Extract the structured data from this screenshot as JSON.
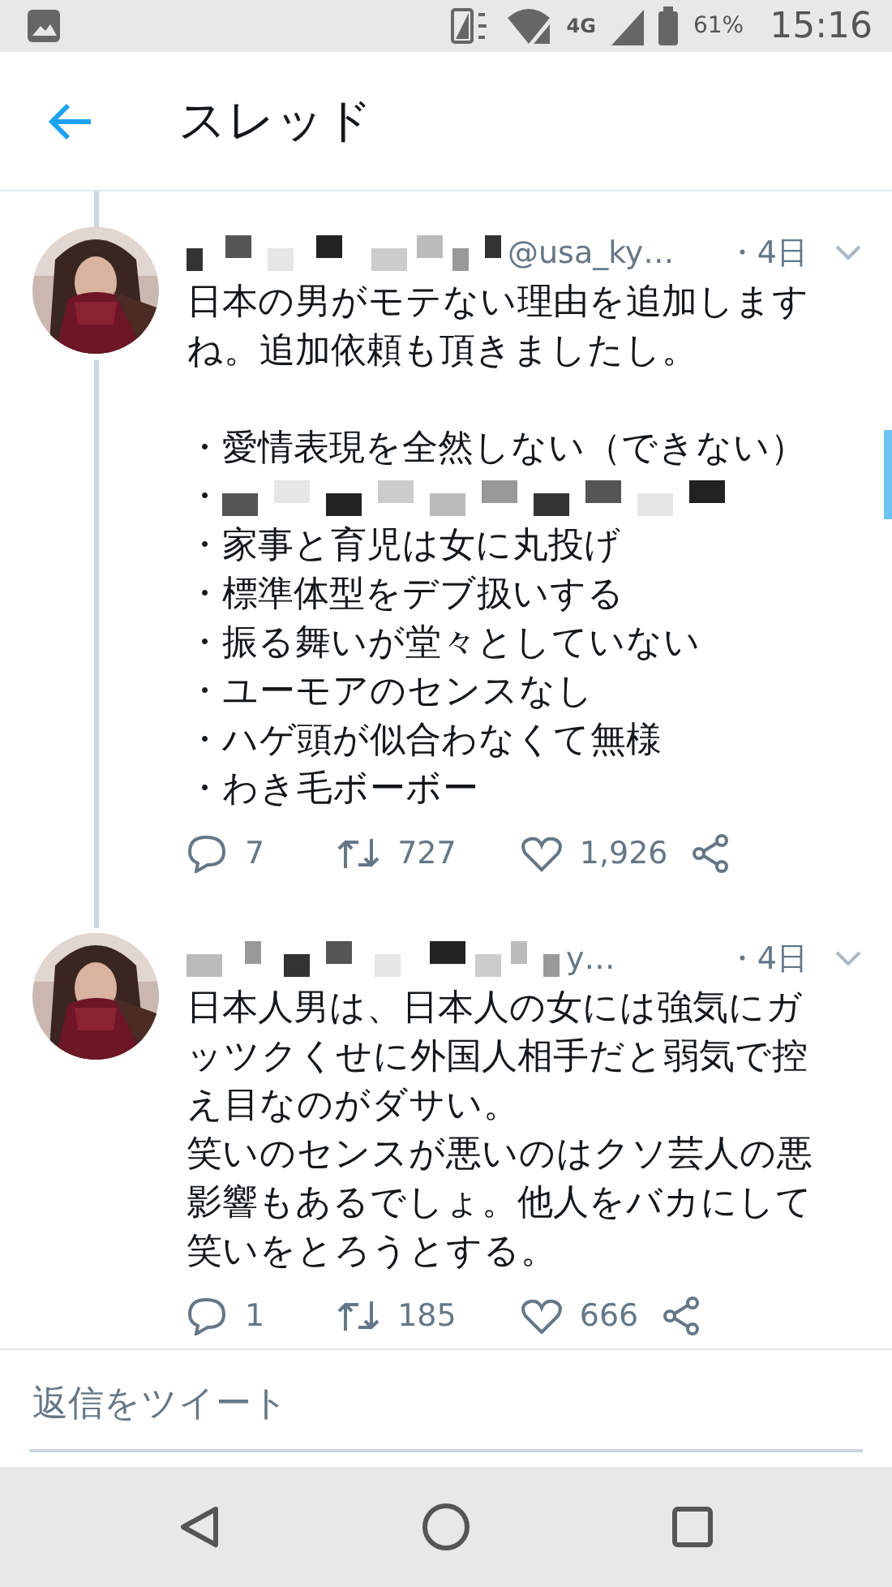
{
  "status_bar": {
    "battery": "61%",
    "time": "15:16",
    "network": "4G"
  },
  "header": {
    "title": "スレッド"
  },
  "tweets": [
    {
      "handle": "@usa_ky…",
      "time": "・4日",
      "paragraphs": [
        "日本の男がモテない理由を追加しますね。追加依頼も頂きましたし。"
      ],
      "bullets": [
        {
          "kind": "text",
          "text": "・愛情表現を全然しない（できない）"
        },
        {
          "kind": "censored",
          "text": "・"
        },
        {
          "kind": "text",
          "text": "・家事と育児は女に丸投げ"
        },
        {
          "kind": "text",
          "text": "・標準体型をデブ扱いする"
        },
        {
          "kind": "text",
          "text": "・振る舞いが堂々としていない"
        },
        {
          "kind": "text",
          "text": "・ユーモアのセンスなし"
        },
        {
          "kind": "text",
          "text": "・ハゲ頭が似合わなくて無様"
        },
        {
          "kind": "text",
          "text": "・わき毛ボーボー"
        }
      ],
      "replies": "7",
      "retweets": "727",
      "likes": "1,926",
      "thread_continues": true
    },
    {
      "handle": "y…",
      "time": "・4日",
      "paragraphs": [
        "日本人男は、日本人の女には強気にガッツクくせに外国人相手だと弱気で控え目なのがダサい。",
        "笑いのセンスが悪いのはクソ芸人の悪影響もあるでしょ。他人をバカにして笑いをとろうとする。"
      ],
      "replies": "1",
      "retweets": "185",
      "likes": "666",
      "thread_continues": false
    }
  ],
  "reply_field": {
    "placeholder": "返信をツイート"
  }
}
